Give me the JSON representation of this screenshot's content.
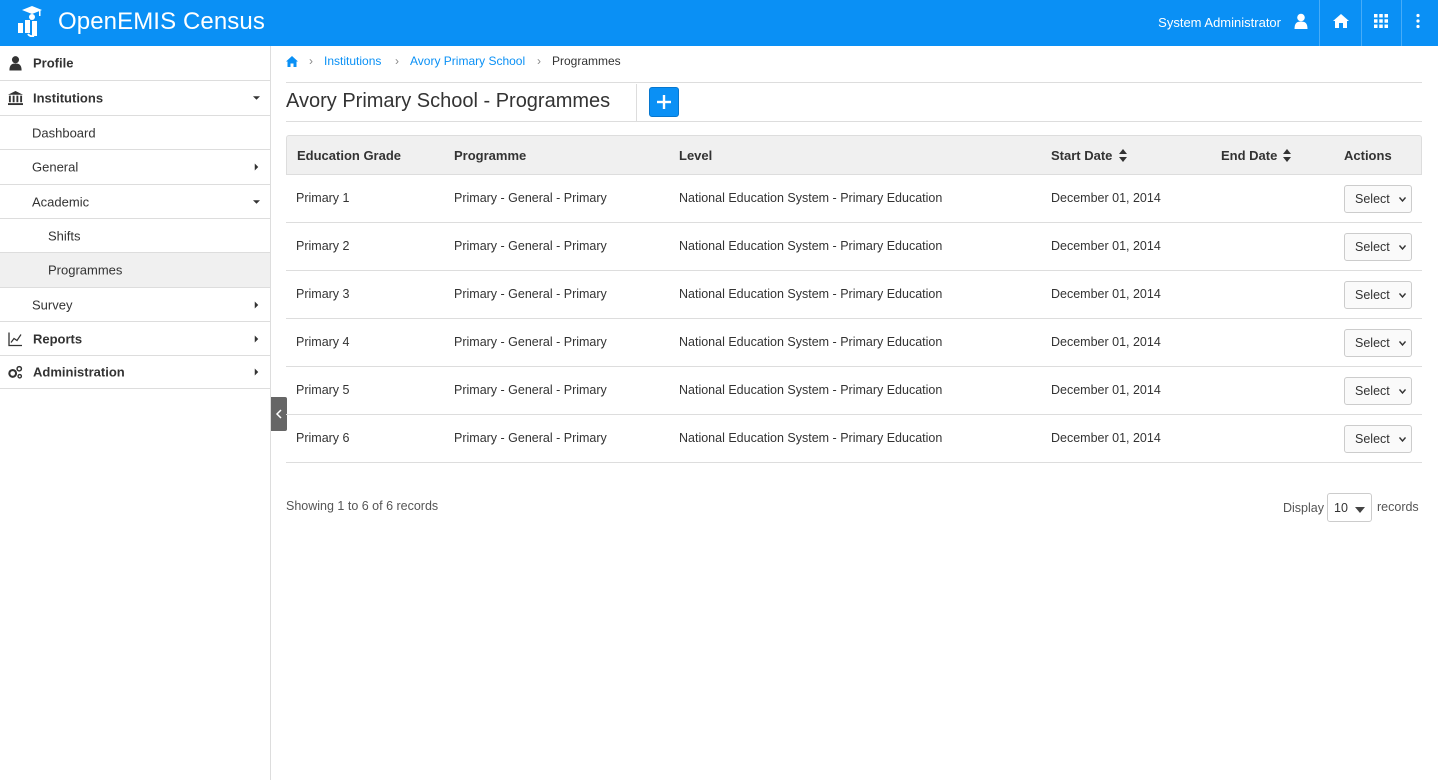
{
  "header": {
    "app_title": "OpenEMIS Census",
    "user_name": "System Administrator",
    "icons": [
      "logo-icon",
      "user-icon",
      "home-icon",
      "apps-grid-icon",
      "more-vertical-icon"
    ]
  },
  "sidebar": {
    "items": [
      {
        "label": "Profile",
        "icon": "user-icon"
      },
      {
        "label": "Institutions",
        "icon": "bank-icon"
      },
      {
        "label": "Dashboard"
      },
      {
        "label": "General"
      },
      {
        "label": "Academic"
      },
      {
        "label": "Shifts"
      },
      {
        "label": "Programmes",
        "active": true
      },
      {
        "label": "Survey"
      },
      {
        "label": "Reports",
        "icon": "line-chart-icon"
      },
      {
        "label": "Administration",
        "icon": "gears-icon"
      }
    ]
  },
  "breadcrumb": {
    "items": [
      "Institutions",
      "Avory Primary School"
    ],
    "current": "Programmes"
  },
  "page": {
    "title": "Avory Primary School - Programmes"
  },
  "table": {
    "headers": [
      "Education Grade",
      "Programme",
      "Level",
      "Start Date",
      "End Date",
      "Actions"
    ],
    "action_label": "Select",
    "rows": [
      {
        "grade": "Primary 1",
        "programme": "Primary - General - Primary",
        "level": "National Education System - Primary Education",
        "start": "December 01, 2014",
        "end": ""
      },
      {
        "grade": "Primary 2",
        "programme": "Primary - General - Primary",
        "level": "National Education System - Primary Education",
        "start": "December 01, 2014",
        "end": ""
      },
      {
        "grade": "Primary 3",
        "programme": "Primary - General - Primary",
        "level": "National Education System - Primary Education",
        "start": "December 01, 2014",
        "end": ""
      },
      {
        "grade": "Primary 4",
        "programme": "Primary - General - Primary",
        "level": "National Education System - Primary Education",
        "start": "December 01, 2014",
        "end": ""
      },
      {
        "grade": "Primary 5",
        "programme": "Primary - General - Primary",
        "level": "National Education System - Primary Education",
        "start": "December 01, 2014",
        "end": ""
      },
      {
        "grade": "Primary 6",
        "programme": "Primary - General - Primary",
        "level": "National Education System - Primary Education",
        "start": "December 01, 2014",
        "end": ""
      }
    ]
  },
  "footer": {
    "showing": "Showing 1 to 6 of 6 records",
    "display_label": "Display",
    "page_size": "10",
    "records_label": "records"
  },
  "colors": {
    "accent": "#0a90f5"
  }
}
